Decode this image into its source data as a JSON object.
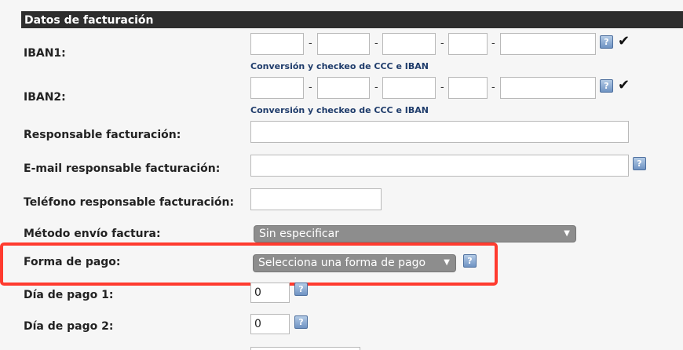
{
  "section": {
    "title": "Datos de facturación"
  },
  "iban1": {
    "label": "IBAN1:",
    "help": "?",
    "check": "✔",
    "link": "Conversión y checkeo de CCC e IBAN"
  },
  "iban2": {
    "label": "IBAN2:",
    "help": "?",
    "check": "✔",
    "link": "Conversión y checkeo de CCC e IBAN"
  },
  "separator": "-",
  "responsable": {
    "label": "Responsable facturación:"
  },
  "email": {
    "label": "E-mail responsable facturación:",
    "help": "?"
  },
  "telefono": {
    "label": "Teléfono responsable facturación:"
  },
  "metodo_envio": {
    "label": "Método envío factura:",
    "selected": "Sin especificar",
    "arrow": "▼"
  },
  "forma_pago": {
    "label": "Forma de pago:",
    "selected": "Selecciona una forma de pago",
    "arrow": "▼",
    "help": "?"
  },
  "dia_pago_1": {
    "label": "Día de pago 1:",
    "value": "0",
    "help": "?"
  },
  "dia_pago_2": {
    "label": "Día de pago 2:",
    "value": "0",
    "help": "?"
  },
  "colors": {
    "highlight": "#ff3b2f",
    "header_bg": "#2e2e2e",
    "select_bg": "#8d8d8d",
    "link": "#1f3c6b"
  }
}
